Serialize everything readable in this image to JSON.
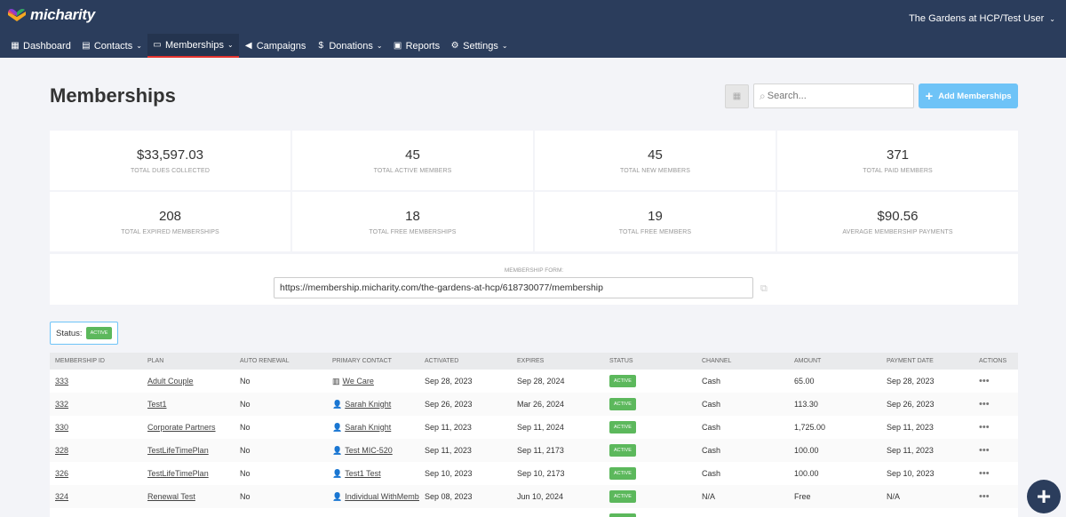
{
  "app": {
    "name": "micharity",
    "org_user": "The Gardens at HCP/Test User"
  },
  "nav": [
    {
      "label": "Dashboard",
      "icon": "dashboard-icon",
      "glyph": "▦",
      "dropdown": false,
      "active": false
    },
    {
      "label": "Contacts",
      "icon": "contacts-icon",
      "glyph": "▤",
      "dropdown": true,
      "active": false
    },
    {
      "label": "Memberships",
      "icon": "memberships-icon",
      "glyph": "▭",
      "dropdown": true,
      "active": true
    },
    {
      "label": "Campaigns",
      "icon": "megaphone-icon",
      "glyph": "◀",
      "dropdown": false,
      "active": false
    },
    {
      "label": "Donations",
      "icon": "dollar-icon",
      "glyph": "$",
      "dropdown": true,
      "active": false
    },
    {
      "label": "Reports",
      "icon": "reports-icon",
      "glyph": "▣",
      "dropdown": false,
      "active": false
    },
    {
      "label": "Settings",
      "icon": "gear-icon",
      "glyph": "⚙",
      "dropdown": true,
      "active": false
    }
  ],
  "page": {
    "title": "Memberships",
    "search_placeholder": "Search...",
    "add_button": "Add Memberships"
  },
  "stats": [
    {
      "value": "$33,597.03",
      "label": "Total Dues Collected"
    },
    {
      "value": "45",
      "label": "Total Active Members"
    },
    {
      "value": "45",
      "label": "Total New Members"
    },
    {
      "value": "371",
      "label": "Total Paid Members"
    },
    {
      "value": "208",
      "label": "Total Expired Memberships"
    },
    {
      "value": "18",
      "label": "Total Free Memberships"
    },
    {
      "value": "19",
      "label": "Total Free Members"
    },
    {
      "value": "$90.56",
      "label": "Average Membership Payments"
    }
  ],
  "membership_form": {
    "label": "Membership Form:",
    "url": "https://membership.micharity.com/the-gardens-at-hcp/618730077/membership"
  },
  "filter": {
    "label": "Status:",
    "value": "Active"
  },
  "table": {
    "columns": [
      "Membership ID",
      "Plan",
      "Auto Renewal",
      "Primary Contact",
      "Activated",
      "Expires",
      "Status",
      "Channel",
      "Amount",
      "Payment Date",
      "Actions"
    ],
    "rows": [
      {
        "id": "333",
        "plan": "Adult Couple",
        "auto_renewal": "No",
        "contact": "We Care",
        "contact_type": "organization",
        "activated": "Sep 28, 2023",
        "expires": "Sep 28, 2024",
        "status": "Active",
        "channel": "Cash",
        "amount": "65.00",
        "payment_date": "Sep 28, 2023"
      },
      {
        "id": "332",
        "plan": "Test1",
        "auto_renewal": "No",
        "contact": "Sarah Knight",
        "contact_type": "person",
        "activated": "Sep 26, 2023",
        "expires": "Mar 26, 2024",
        "status": "Active",
        "channel": "Cash",
        "amount": "113.30",
        "payment_date": "Sep 26, 2023"
      },
      {
        "id": "330",
        "plan": "Corporate Partners",
        "auto_renewal": "No",
        "contact": "Sarah Knight",
        "contact_type": "person",
        "activated": "Sep 11, 2023",
        "expires": "Sep 11, 2024",
        "status": "Active",
        "channel": "Cash",
        "amount": "1,725.00",
        "payment_date": "Sep 11, 2023"
      },
      {
        "id": "328",
        "plan": "TestLifeTimePlan",
        "auto_renewal": "No",
        "contact": "Test MIC-520",
        "contact_type": "person",
        "activated": "Sep 11, 2023",
        "expires": "Sep 11, 2173",
        "status": "Active",
        "channel": "Cash",
        "amount": "100.00",
        "payment_date": "Sep 11, 2023"
      },
      {
        "id": "326",
        "plan": "TestLifeTimePlan",
        "auto_renewal": "No",
        "contact": "Test1 Test",
        "contact_type": "person",
        "activated": "Sep 10, 2023",
        "expires": "Sep 10, 2173",
        "status": "Active",
        "channel": "Cash",
        "amount": "100.00",
        "payment_date": "Sep 10, 2023"
      },
      {
        "id": "324",
        "plan": "Renewal Test",
        "auto_renewal": "No",
        "contact": "Individual WithMember",
        "contact_type": "person",
        "activated": "Sep 08, 2023",
        "expires": "Jun 10, 2024",
        "status": "Active",
        "channel": "N/A",
        "amount": "Free",
        "payment_date": "N/A"
      },
      {
        "id": "",
        "plan": "",
        "auto_renewal": "",
        "contact": "",
        "contact_type": "person",
        "activated": "",
        "expires": "",
        "status": "Active",
        "channel": "",
        "amount": "",
        "payment_date": ""
      }
    ]
  },
  "colors": {
    "nav_bg": "#2b3d5c",
    "active_underline": "#e3342f",
    "accent": "#6ec3f7",
    "status_active": "#5cb85c"
  }
}
